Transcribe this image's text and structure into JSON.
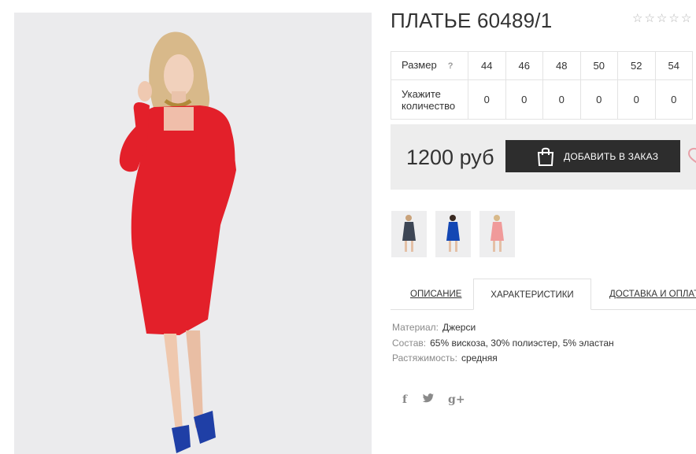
{
  "product": {
    "title": "ПЛАТЬЕ 60489/1",
    "rating_stars": 5,
    "rating_value": 0,
    "image": {
      "dress_color": "#e3202a",
      "shoe_color": "#1f3fa6"
    }
  },
  "sizes": {
    "size_label": "Размер",
    "help": "?",
    "qty_label": "Укажите количество",
    "items": [
      {
        "size": "44",
        "qty": "0"
      },
      {
        "size": "46",
        "qty": "0"
      },
      {
        "size": "48",
        "qty": "0"
      },
      {
        "size": "50",
        "qty": "0"
      },
      {
        "size": "52",
        "qty": "0"
      },
      {
        "size": "54",
        "qty": "0"
      }
    ]
  },
  "buy": {
    "price": "1200 руб",
    "add_label": "ДОБАВИТЬ В ЗАКАЗ"
  },
  "thumbnails": [
    {
      "name": "thumb-grey",
      "color": "#3d4655"
    },
    {
      "name": "thumb-blue",
      "color": "#1347b4"
    },
    {
      "name": "thumb-pink",
      "color": "#f09a9a"
    }
  ],
  "tabs": [
    {
      "label": "ОПИСАНИЕ",
      "active": false
    },
    {
      "label": "ХАРАКТЕРИСТИКИ",
      "active": true
    },
    {
      "label": "ДОСТАВКА И ОПЛАТА",
      "active": false
    }
  ],
  "specs": [
    {
      "key": "Материал:",
      "value": "Джерси"
    },
    {
      "key": "Состав:",
      "value": "65% вискоза, 30% полиэстер, 5% эластан"
    },
    {
      "key": "Растяжимость:",
      "value": "средняя"
    }
  ],
  "share": {
    "facebook": "f",
    "google": "g+"
  },
  "colors": {
    "button_bg": "#2d2d2d",
    "buybox_bg": "#ededed",
    "heart": "#e8a0a8"
  }
}
